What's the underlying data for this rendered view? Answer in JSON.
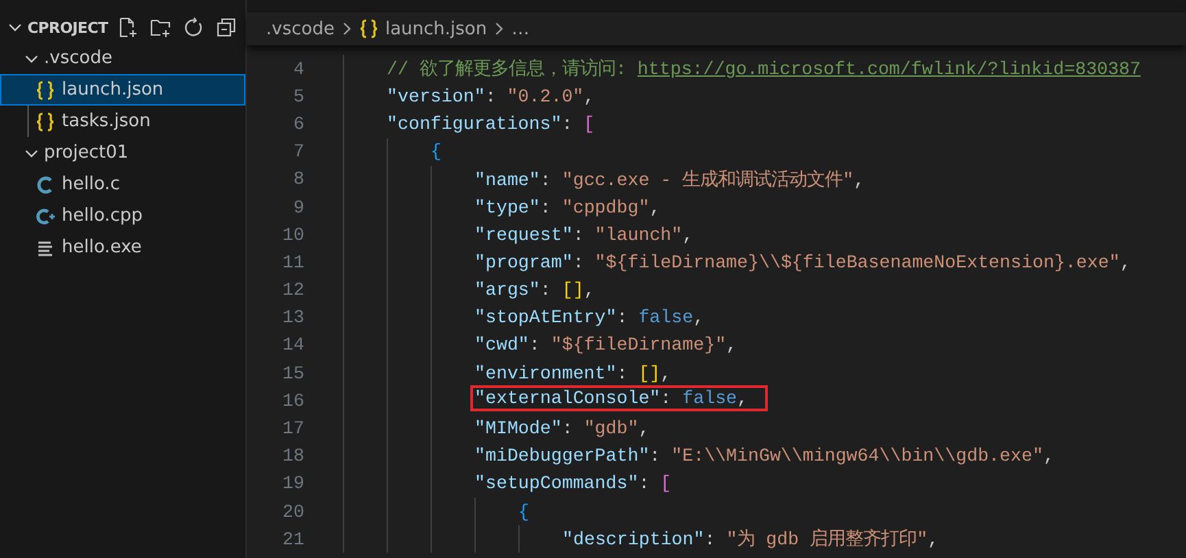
{
  "sidebar": {
    "title": "CPROJECT",
    "expanded": true,
    "tree": [
      {
        "label": ".vscode",
        "kind": "folder",
        "expanded": true,
        "selected": false,
        "children": [
          {
            "label": "launch.json",
            "kind": "json",
            "selected": true
          },
          {
            "label": "tasks.json",
            "kind": "json",
            "selected": false
          }
        ]
      },
      {
        "label": "project01",
        "kind": "folder",
        "expanded": true,
        "selected": false,
        "children": [
          {
            "label": "hello.c",
            "kind": "c",
            "selected": false
          },
          {
            "label": "hello.cpp",
            "kind": "cpp",
            "selected": false
          },
          {
            "label": "hello.exe",
            "kind": "exe",
            "selected": false
          }
        ]
      }
    ]
  },
  "breadcrumb": [
    {
      "label": ".vscode",
      "kind": "folder"
    },
    {
      "label": "launch.json",
      "kind": "json"
    },
    {
      "label": "…",
      "kind": "more"
    }
  ],
  "editor": {
    "lines": [
      {
        "number": "4",
        "highlighted": false,
        "tokens": [
          {
            "text": "// 欲了解更多信息，请访问: ",
            "kind": "comment"
          },
          {
            "text": "https://go.microsoft.com/fwlink/?linkid=830387",
            "kind": "link"
          }
        ]
      },
      {
        "number": "5",
        "highlighted": false,
        "tokens": [
          {
            "text": "\"version\"",
            "kind": "key"
          },
          {
            "text": ": ",
            "kind": "punct"
          },
          {
            "text": "\"0.2.0\"",
            "kind": "string"
          },
          {
            "text": ",",
            "kind": "punct"
          }
        ]
      },
      {
        "number": "6",
        "highlighted": false,
        "tokens": [
          {
            "text": "\"configurations\"",
            "kind": "key"
          },
          {
            "text": ": ",
            "kind": "punct"
          },
          {
            "text": "[",
            "kind": "bracket2"
          }
        ],
        "children": [
          {
            "number": "7",
            "highlighted": false,
            "tokens": [
              {
                "text": "{",
                "kind": "bracket3"
              }
            ],
            "children": [
              {
                "number": "8",
                "highlighted": false,
                "tokens": [
                  {
                    "text": "\"name\"",
                    "kind": "key"
                  },
                  {
                    "text": ": ",
                    "kind": "punct"
                  },
                  {
                    "text": "\"gcc.exe - 生成和调试活动文件\"",
                    "kind": "string"
                  },
                  {
                    "text": ",",
                    "kind": "punct"
                  }
                ]
              },
              {
                "number": "9",
                "highlighted": false,
                "tokens": [
                  {
                    "text": "\"type\"",
                    "kind": "key"
                  },
                  {
                    "text": ": ",
                    "kind": "punct"
                  },
                  {
                    "text": "\"cppdbg\"",
                    "kind": "string"
                  },
                  {
                    "text": ",",
                    "kind": "punct"
                  }
                ]
              },
              {
                "number": "10",
                "highlighted": false,
                "tokens": [
                  {
                    "text": "\"request\"",
                    "kind": "key"
                  },
                  {
                    "text": ": ",
                    "kind": "punct"
                  },
                  {
                    "text": "\"launch\"",
                    "kind": "string"
                  },
                  {
                    "text": ",",
                    "kind": "punct"
                  }
                ]
              },
              {
                "number": "11",
                "highlighted": false,
                "tokens": [
                  {
                    "text": "\"program\"",
                    "kind": "key"
                  },
                  {
                    "text": ": ",
                    "kind": "punct"
                  },
                  {
                    "text": "\"${fileDirname}\\\\${fileBasenameNoExtension}.exe\"",
                    "kind": "string"
                  },
                  {
                    "text": ",",
                    "kind": "punct"
                  }
                ]
              },
              {
                "number": "12",
                "highlighted": false,
                "tokens": [
                  {
                    "text": "\"args\"",
                    "kind": "key"
                  },
                  {
                    "text": ": ",
                    "kind": "punct"
                  },
                  {
                    "text": "[]",
                    "kind": "bracket1"
                  },
                  {
                    "text": ",",
                    "kind": "punct"
                  }
                ]
              },
              {
                "number": "13",
                "highlighted": false,
                "tokens": [
                  {
                    "text": "\"stopAtEntry\"",
                    "kind": "key"
                  },
                  {
                    "text": ": ",
                    "kind": "punct"
                  },
                  {
                    "text": "false",
                    "kind": "bool"
                  },
                  {
                    "text": ",",
                    "kind": "punct"
                  }
                ]
              },
              {
                "number": "14",
                "highlighted": false,
                "tokens": [
                  {
                    "text": "\"cwd\"",
                    "kind": "key"
                  },
                  {
                    "text": ": ",
                    "kind": "punct"
                  },
                  {
                    "text": "\"${fileDirname}\"",
                    "kind": "string"
                  },
                  {
                    "text": ",",
                    "kind": "punct"
                  }
                ]
              },
              {
                "number": "15",
                "highlighted": false,
                "tokens": [
                  {
                    "text": "\"environment\"",
                    "kind": "key"
                  },
                  {
                    "text": ": ",
                    "kind": "punct"
                  },
                  {
                    "text": "[]",
                    "kind": "bracket1"
                  },
                  {
                    "text": ",",
                    "kind": "punct"
                  }
                ]
              },
              {
                "number": "16",
                "highlighted": true,
                "tokens": [
                  {
                    "text": "\"externalConsole\"",
                    "kind": "key"
                  },
                  {
                    "text": ": ",
                    "kind": "punct"
                  },
                  {
                    "text": "false",
                    "kind": "bool"
                  },
                  {
                    "text": ",",
                    "kind": "punct"
                  }
                ]
              },
              {
                "number": "17",
                "highlighted": false,
                "tokens": [
                  {
                    "text": "\"MIMode\"",
                    "kind": "key"
                  },
                  {
                    "text": ": ",
                    "kind": "punct"
                  },
                  {
                    "text": "\"gdb\"",
                    "kind": "string"
                  },
                  {
                    "text": ",",
                    "kind": "punct"
                  }
                ]
              },
              {
                "number": "18",
                "highlighted": false,
                "tokens": [
                  {
                    "text": "\"miDebuggerPath\"",
                    "kind": "key"
                  },
                  {
                    "text": ": ",
                    "kind": "punct"
                  },
                  {
                    "text": "\"E:\\\\MinGw\\\\mingw64\\\\bin\\\\gdb.exe\"",
                    "kind": "string"
                  },
                  {
                    "text": ",",
                    "kind": "punct"
                  }
                ]
              },
              {
                "number": "19",
                "highlighted": false,
                "tokens": [
                  {
                    "text": "\"setupCommands\"",
                    "kind": "key"
                  },
                  {
                    "text": ": ",
                    "kind": "punct"
                  },
                  {
                    "text": "[",
                    "kind": "bracket2"
                  }
                ],
                "children": [
                  {
                    "number": "20",
                    "highlighted": false,
                    "tokens": [
                      {
                        "text": "{",
                        "kind": "bracket3"
                      }
                    ],
                    "children": [
                      {
                        "number": "21",
                        "highlighted": false,
                        "tokens": [
                          {
                            "text": "\"description\"",
                            "kind": "key"
                          },
                          {
                            "text": ": ",
                            "kind": "punct"
                          },
                          {
                            "text": "\"为 gdb 启用整齐打印\"",
                            "kind": "string"
                          },
                          {
                            "text": ",",
                            "kind": "punct"
                          }
                        ]
                      }
                    ]
                  }
                ]
              }
            ]
          }
        ]
      }
    ]
  }
}
